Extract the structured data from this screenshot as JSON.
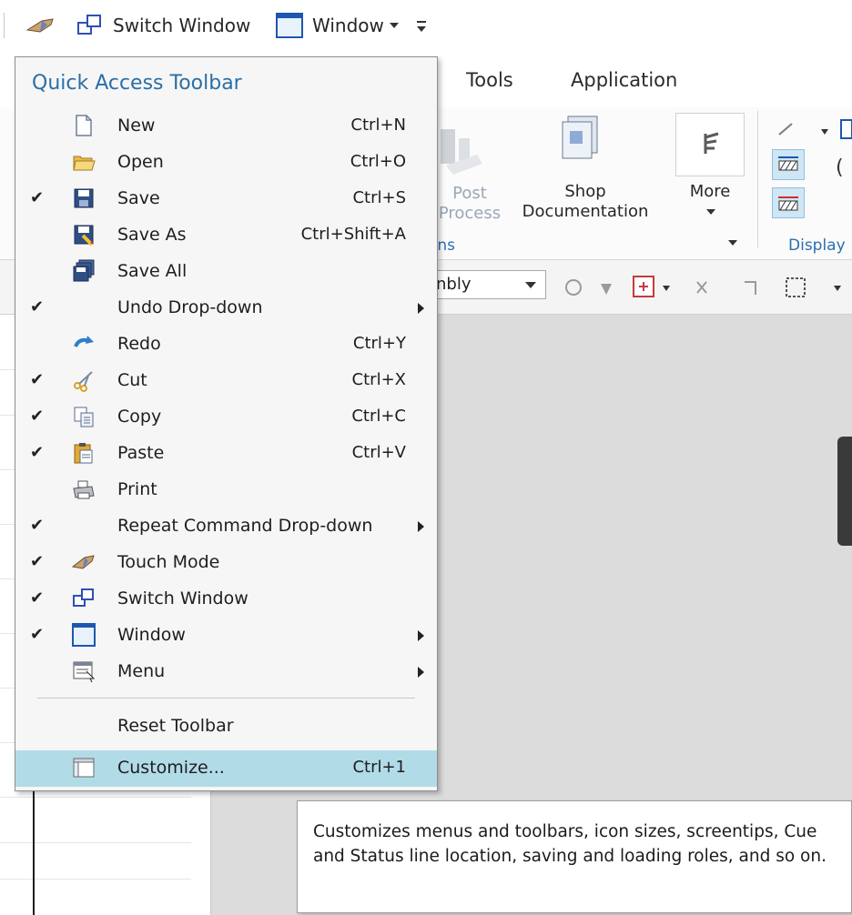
{
  "qat": {
    "switch_window_label": "Switch Window",
    "window_label": "Window"
  },
  "menubar": {
    "tabs": [
      "Tools",
      "Application"
    ]
  },
  "ribbon": {
    "post_process_label": "Post Process",
    "shop_documentation_label": "Shop Documentation",
    "more_label": "More",
    "group_operations_fragment": "ons",
    "group_display_label": "Display",
    "assembly_combo_value": "nbly"
  },
  "menu": {
    "title": "Quick Access Toolbar",
    "items": [
      {
        "label": "New",
        "shortcut": "Ctrl+N",
        "checked": false,
        "icon": "new-document-icon",
        "submenu": false
      },
      {
        "label": "Open",
        "shortcut": "Ctrl+O",
        "checked": false,
        "icon": "open-folder-icon",
        "submenu": false
      },
      {
        "label": "Save",
        "shortcut": "Ctrl+S",
        "checked": true,
        "icon": "save-icon",
        "submenu": false
      },
      {
        "label": "Save As",
        "shortcut": "Ctrl+Shift+A",
        "checked": false,
        "icon": "save-as-icon",
        "submenu": false
      },
      {
        "label": "Save All",
        "shortcut": "",
        "checked": false,
        "icon": "save-all-icon",
        "submenu": false
      },
      {
        "label": "Undo Drop-down",
        "shortcut": "",
        "checked": true,
        "icon": "",
        "submenu": true
      },
      {
        "label": "Redo",
        "shortcut": "Ctrl+Y",
        "checked": false,
        "icon": "redo-icon",
        "submenu": false
      },
      {
        "label": "Cut",
        "shortcut": "Ctrl+X",
        "checked": true,
        "icon": "cut-icon",
        "submenu": false
      },
      {
        "label": "Copy",
        "shortcut": "Ctrl+C",
        "checked": true,
        "icon": "copy-icon",
        "submenu": false
      },
      {
        "label": "Paste",
        "shortcut": "Ctrl+V",
        "checked": true,
        "icon": "paste-icon",
        "submenu": false
      },
      {
        "label": "Print",
        "shortcut": "",
        "checked": false,
        "icon": "print-icon",
        "submenu": false
      },
      {
        "label": "Repeat Command Drop-down",
        "shortcut": "",
        "checked": true,
        "icon": "",
        "submenu": true
      },
      {
        "label": "Touch Mode",
        "shortcut": "",
        "checked": true,
        "icon": "touch-mode-icon",
        "submenu": false
      },
      {
        "label": "Switch Window",
        "shortcut": "",
        "checked": true,
        "icon": "switch-window-icon",
        "submenu": false
      },
      {
        "label": "Window",
        "shortcut": "",
        "checked": true,
        "icon": "window-icon",
        "submenu": true
      },
      {
        "label": "Menu",
        "shortcut": "",
        "checked": false,
        "icon": "menu-icon",
        "submenu": true
      }
    ],
    "reset_label": "Reset Toolbar",
    "customize_label": "Customize...",
    "customize_shortcut": "Ctrl+1",
    "check_glyph": "✔"
  },
  "tooltip": {
    "text": "Customizes menus and toolbars, icon sizes, screentips, Cue and Status line location, saving and loading roles, and so on."
  }
}
